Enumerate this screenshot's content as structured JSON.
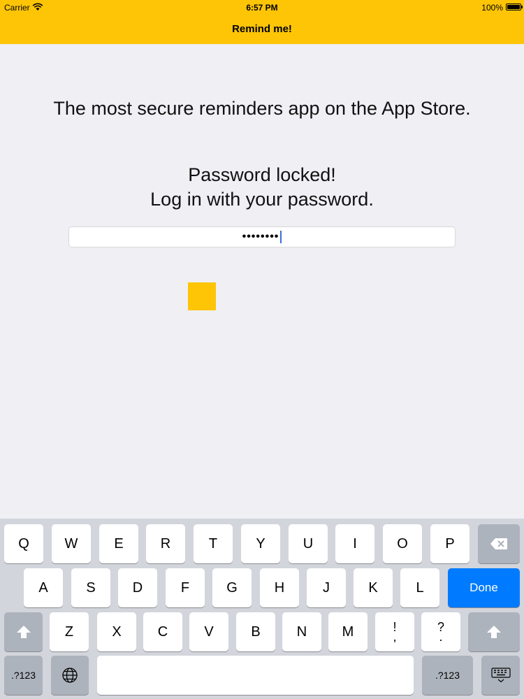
{
  "status_bar": {
    "carrier": "Carrier",
    "time": "6:57 PM",
    "battery": "100%"
  },
  "nav": {
    "title": "Remind me!"
  },
  "main": {
    "tagline": "The most secure reminders app on the App Store.",
    "lock_line1": "Password locked!",
    "lock_line2": "Log in with your password.",
    "password_value": "••••••••"
  },
  "colors": {
    "accent": "#fdc506",
    "background": "#efeff4",
    "done_key": "#007aff",
    "caret": "#3b6fd6"
  },
  "keyboard": {
    "row1": [
      "Q",
      "W",
      "E",
      "R",
      "T",
      "Y",
      "U",
      "I",
      "O",
      "P"
    ],
    "row2": [
      "A",
      "S",
      "D",
      "F",
      "G",
      "H",
      "J",
      "K",
      "L"
    ],
    "row3": [
      "Z",
      "X",
      "C",
      "V",
      "B",
      "N",
      "M"
    ],
    "done": "Done",
    "numbers_left": ".?123",
    "numbers_right": ".?123",
    "punct1_top": "!",
    "punct1_bottom": ",",
    "punct2_top": "?",
    "punct2_bottom": "."
  }
}
